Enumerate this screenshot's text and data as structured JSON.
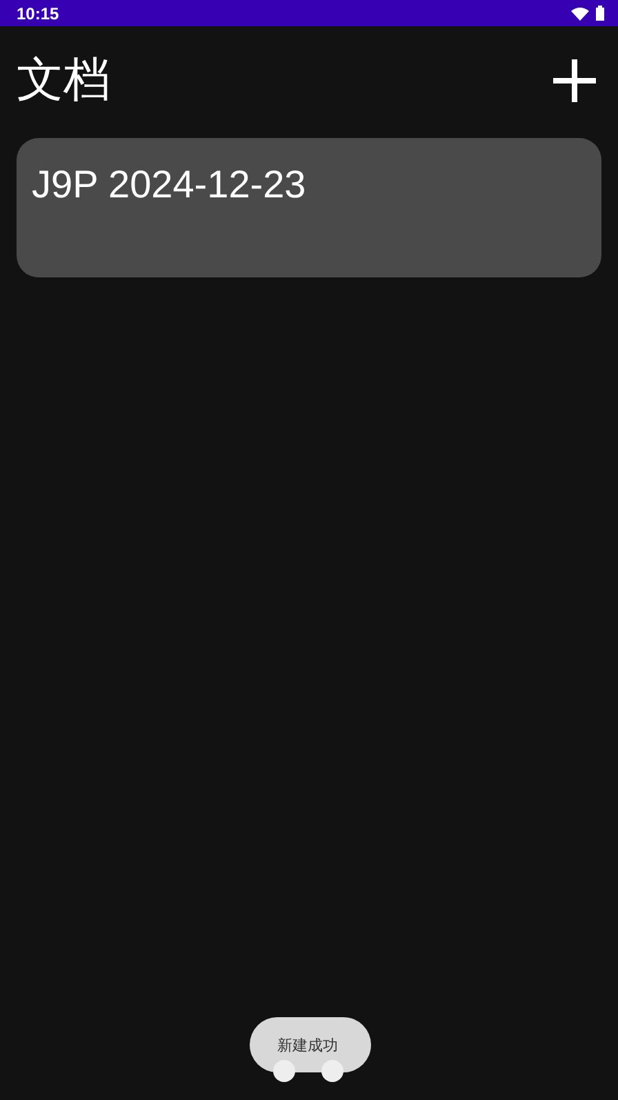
{
  "status_bar": {
    "time": "10:15"
  },
  "header": {
    "title": "文档"
  },
  "documents": [
    {
      "name": "J9P 2024-12-23"
    }
  ],
  "toast": {
    "message": "新建成功"
  }
}
